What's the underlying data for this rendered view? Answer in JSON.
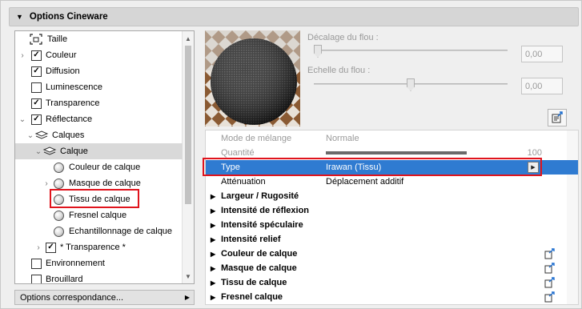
{
  "panel": {
    "title": "Options Cineware"
  },
  "tree": {
    "items": [
      {
        "label": "Taille",
        "kind": "size",
        "checked": null
      },
      {
        "label": "Couleur",
        "kind": "check",
        "checked": true,
        "chevron": true
      },
      {
        "label": "Diffusion",
        "kind": "check",
        "checked": true
      },
      {
        "label": "Luminescence",
        "kind": "check",
        "checked": false
      },
      {
        "label": "Transparence",
        "kind": "check",
        "checked": true
      },
      {
        "label": "Réflectance",
        "kind": "check",
        "checked": true,
        "chevron_open": true
      },
      {
        "label": "Calques",
        "kind": "layers",
        "chevron_open": true
      },
      {
        "label": "Calque",
        "kind": "layers",
        "chevron_open": true,
        "selected": true
      },
      {
        "label": "Couleur de calque",
        "kind": "sphere"
      },
      {
        "label": "Masque de calque",
        "kind": "sphere",
        "chevron": true
      },
      {
        "label": "Tissu de calque",
        "kind": "sphere",
        "highlighted": true
      },
      {
        "label": "Fresnel calque",
        "kind": "sphere"
      },
      {
        "label": "Echantillonnage de calque",
        "kind": "sphere"
      },
      {
        "label": "* Transparence *",
        "kind": "check",
        "checked": true,
        "chevron": true
      },
      {
        "label": "Environnement",
        "kind": "check",
        "checked": false
      },
      {
        "label": "Brouillard",
        "kind": "check",
        "checked": false
      }
    ]
  },
  "dropdown": {
    "label": "Options correspondance..."
  },
  "blur": {
    "offset_label": "Décalage du flou :",
    "offset_value": "0,00",
    "offset_level": 0.0,
    "scale_label": "Echelle du flou :",
    "scale_value": "0,00",
    "scale_level": 0.5
  },
  "props": {
    "mode_label": "Mode de mélange",
    "mode_value": "Normale",
    "quantity_label": "Quantité",
    "quantity_value": "100",
    "quantity_level": 1.0,
    "type_label": "Type",
    "type_value": "Irawan (Tissu)",
    "atten_label": "Atténuation",
    "atten_value": "Déplacement additif",
    "sections": [
      {
        "label": "Largeur / Rugosité",
        "link": false
      },
      {
        "label": "Intensité de réflexion",
        "link": false
      },
      {
        "label": "Intensité spéculaire",
        "link": false
      },
      {
        "label": "Intensité relief",
        "link": false
      },
      {
        "label": "Couleur de calque",
        "link": true
      },
      {
        "label": "Masque de calque",
        "link": true
      },
      {
        "label": "Tissu de calque",
        "link": true
      },
      {
        "label": "Fresnel calque",
        "link": true
      }
    ]
  },
  "colors": {
    "highlight": "#2f7bd1",
    "callout": "#e0141d"
  }
}
